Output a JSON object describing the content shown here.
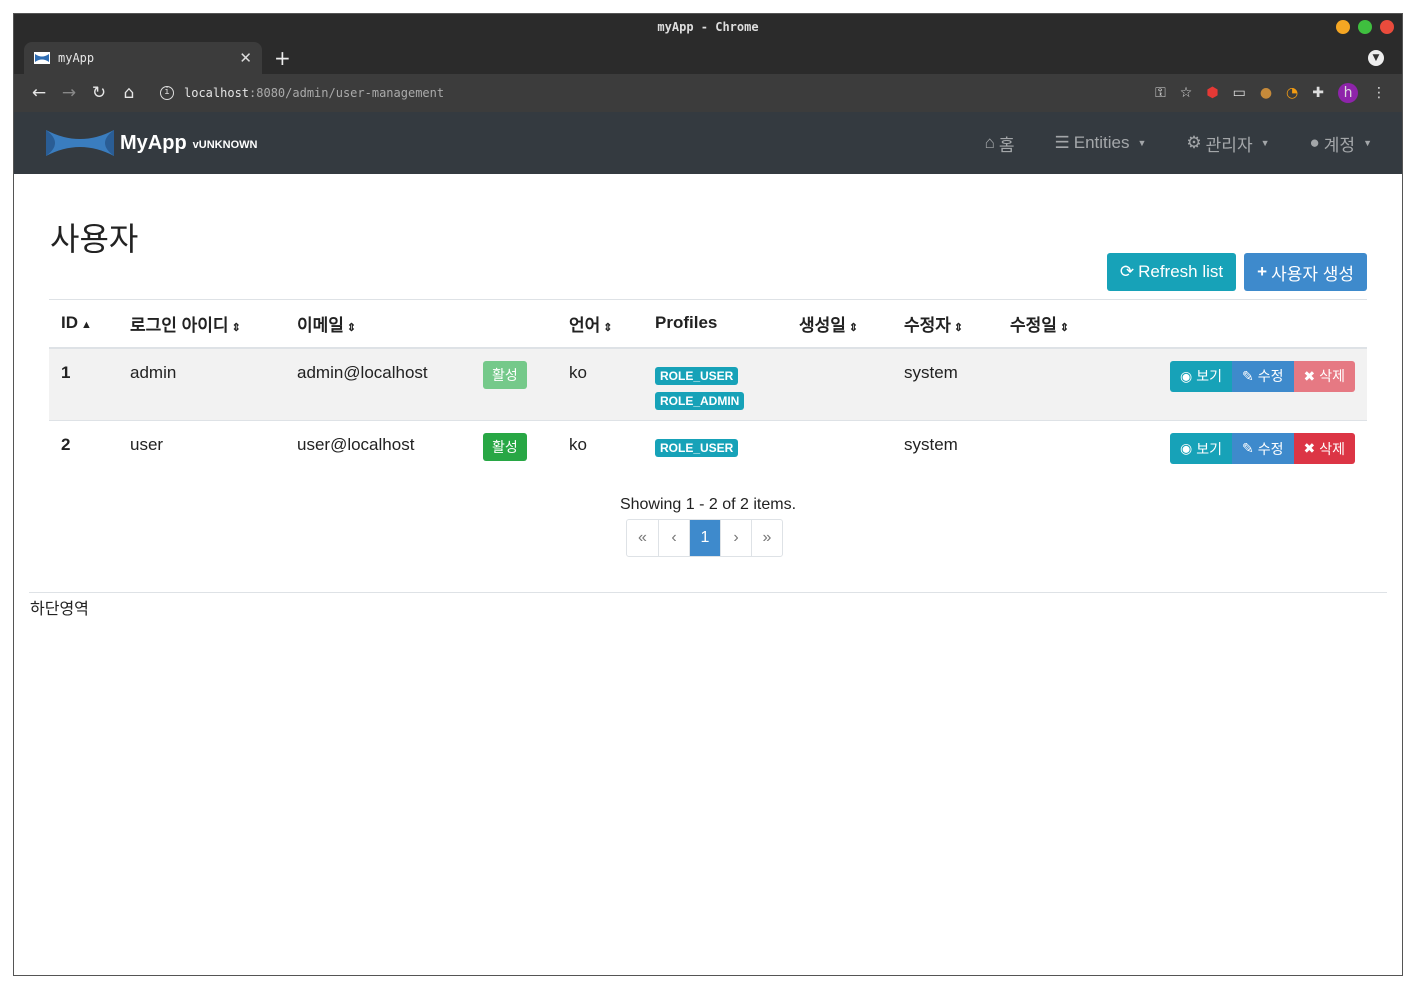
{
  "window": {
    "title": "myApp - Chrome"
  },
  "tab": {
    "title": "myApp"
  },
  "address": {
    "host": "localhost",
    "rest": ":8080/admin/user-management"
  },
  "brand": {
    "name": "MyApp",
    "version": "vUNKNOWN"
  },
  "nav": {
    "home": "홈",
    "entities": "Entities",
    "admin": "관리자",
    "account": "계정"
  },
  "page": {
    "title": "사용자",
    "refresh_label": "Refresh list",
    "create_label": "사용자 생성"
  },
  "table": {
    "headers": {
      "id": "ID",
      "login": "로그인 아이디",
      "email": "이메일",
      "lang": "언어",
      "profiles": "Profiles",
      "created": "생성일",
      "modifier": "수정자",
      "modified": "수정일"
    },
    "rows": [
      {
        "id": "1",
        "login": "admin",
        "email": "admin@localhost",
        "status": "활성",
        "lang": "ko",
        "roles": [
          "ROLE_USER",
          "ROLE_ADMIN"
        ],
        "modifier": "system"
      },
      {
        "id": "2",
        "login": "user",
        "email": "user@localhost",
        "status": "활성",
        "lang": "ko",
        "roles": [
          "ROLE_USER"
        ],
        "modifier": "system"
      }
    ],
    "actions": {
      "view": "보기",
      "edit": "수정",
      "delete": "삭제"
    }
  },
  "pagination": {
    "summary": "Showing 1 - 2 of 2 items.",
    "first": "«",
    "prev": "‹",
    "current": "1",
    "next": "›",
    "last": "»"
  },
  "footer": {
    "text": "하단영역"
  },
  "colors": {
    "navbar": "#343a40",
    "info": "#17a2b8",
    "primary": "#3e8acc",
    "success": "#28a745",
    "danger": "#dc3545"
  }
}
